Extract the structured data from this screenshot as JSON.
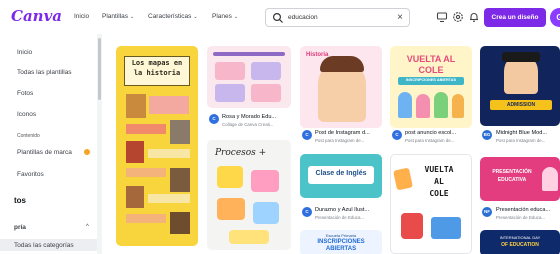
{
  "header": {
    "logo": "Canva",
    "nav": [
      {
        "label": "Inicio",
        "chevron": false
      },
      {
        "label": "Plantillas",
        "chevron": true
      },
      {
        "label": "Características",
        "chevron": true
      },
      {
        "label": "Planes",
        "chevron": true
      }
    ],
    "search": {
      "value": "educacion",
      "placeholder": "Busca plantillas de Canva"
    },
    "create_button": "Crea un diseño",
    "avatar_letter": "G"
  },
  "sidebar": {
    "items": [
      {
        "label": "Inicio"
      },
      {
        "label": "Todas las plantillas"
      },
      {
        "label": "Fotos"
      },
      {
        "label": "Iconos"
      }
    ],
    "section_small": "Contenido",
    "brand_item": "Plantillas de marca",
    "favorites": "Favoritos",
    "heading_tos": "tos",
    "heading_pria": "pría",
    "active_item": "Todas las categorías"
  },
  "cards": {
    "mapas": {
      "line1": "Los mapas en",
      "line2": "la historia"
    },
    "col2a": {
      "title": "Rosa y Morado Edu...",
      "sub": "Collage de Canva Creati..."
    },
    "procesos": {
      "title": "Procesos +"
    },
    "col3a": {
      "title": "Post de Instagram d...",
      "sub": "Post para Instagram de...",
      "badge": "Historia"
    },
    "clase": {
      "title": "Clase de Inglés"
    },
    "col3b": {
      "title": "Durazno y Azul Ilust...",
      "sub": "Presentación de Educa..."
    },
    "col3c": {
      "line1": "Escuela Primaria",
      "line2": "INSCRIPCIONES",
      "line3": "ABIERTAS"
    },
    "vuelta1": {
      "line1": "VUELTA AL",
      "line2": "COLE",
      "ribbon": "INSCRIPCIONES ABIERTAS"
    },
    "col4a": {
      "title": "post anuncio escol...",
      "sub": "Post para Instagram de..."
    },
    "vuelta2": {
      "line1": "VUELTA",
      "line2": "AL",
      "line3": "COLE"
    },
    "col5a": {
      "title": "Midnight Blue Mod...",
      "sub": "Post para Instagram de...",
      "badge": "ADMISSION",
      "avatar": "BG"
    },
    "col5b": {
      "title": "Presentación educa...",
      "sub": "Presentación de Educa...",
      "line1": "PRESENTACIÓN",
      "line2": "EDUCATIVA",
      "avatar": "NF"
    },
    "col5c": {
      "line1": "INTERNATIONAL DAY",
      "line2": "OF EDUCATION"
    }
  }
}
